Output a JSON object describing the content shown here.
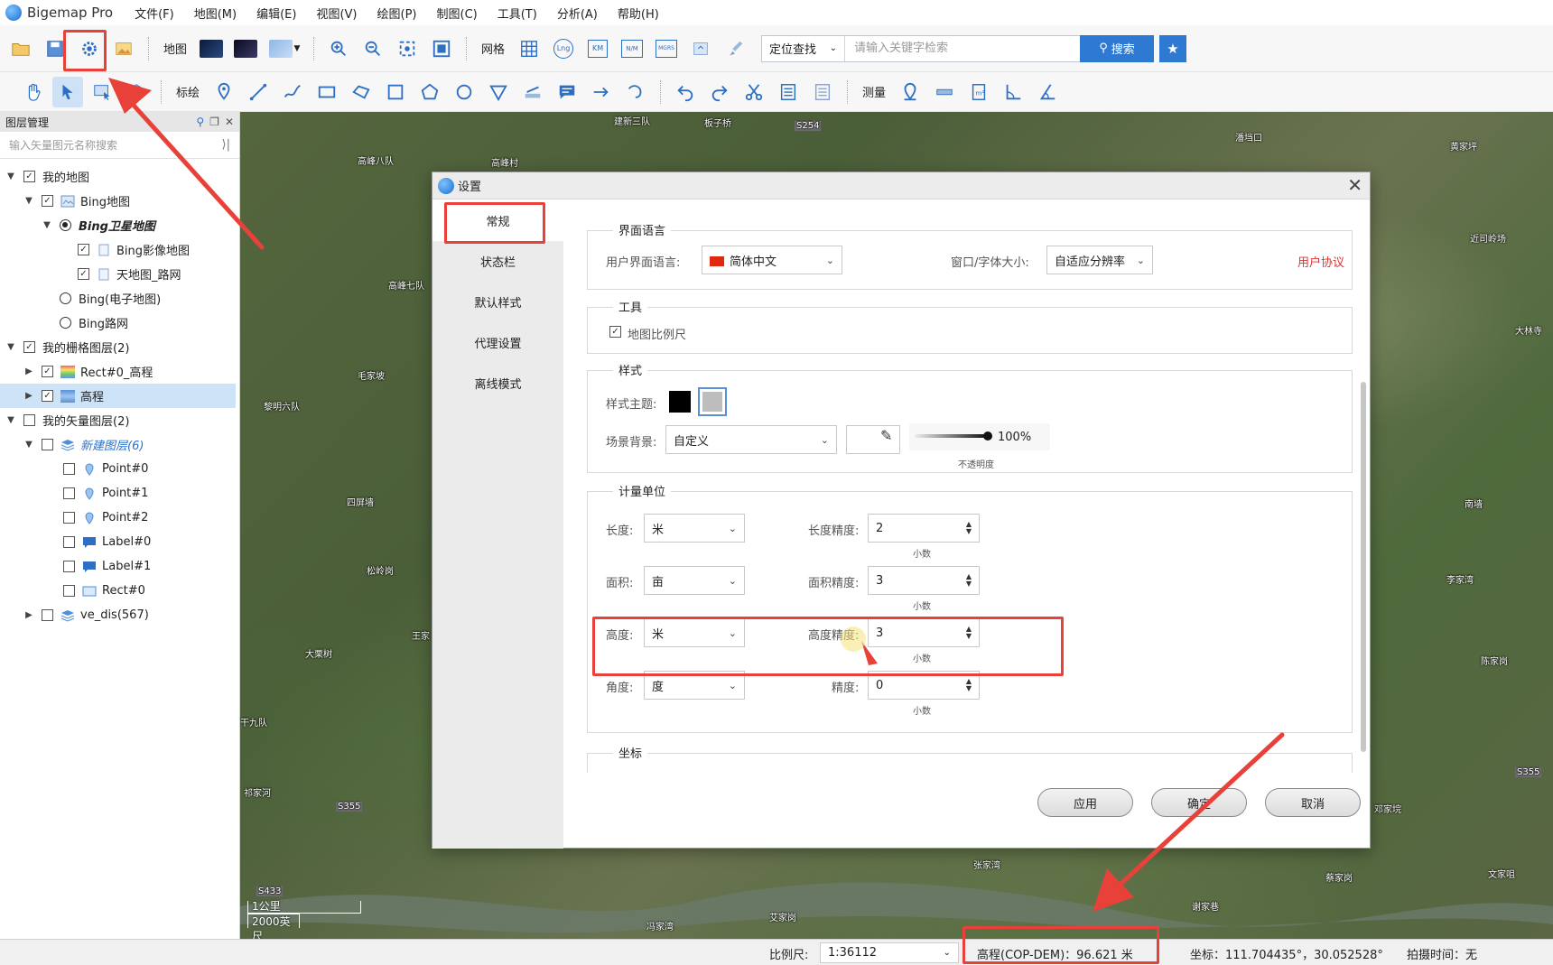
{
  "app": {
    "title": "Bigemap Pro"
  },
  "menu": [
    "文件(F)",
    "地图(M)",
    "编辑(E)",
    "视图(V)",
    "绘图(P)",
    "制图(C)",
    "工具(T)",
    "分析(A)",
    "帮助(H)"
  ],
  "toolbar1": {
    "map_label": "地图",
    "grid_label": "网格",
    "grid_badges": [
      "Lng",
      "KM",
      "N/M",
      "MGRS"
    ],
    "search_type": "定位查找",
    "search_placeholder": "请输入关键字检索",
    "search_button": "搜索"
  },
  "toolbar2": {
    "draw_label": "标绘",
    "measure_label": "测量"
  },
  "layer_panel": {
    "title": "图层管理",
    "search_placeholder": "输入矢量图元名称搜索",
    "tree": [
      {
        "label": "我的地图"
      },
      {
        "label": "Bing地图"
      },
      {
        "label": "Bing卫星地图"
      },
      {
        "label": "Bing影像地图"
      },
      {
        "label": "天地图_路网"
      },
      {
        "label": "Bing(电子地图)"
      },
      {
        "label": "Bing路网"
      },
      {
        "label": "我的栅格图层(2)"
      },
      {
        "label": "Rect#0_高程"
      },
      {
        "label": "高程"
      },
      {
        "label": "我的矢量图层(2)"
      },
      {
        "label": "新建图层(6)"
      },
      {
        "label": "Point#0"
      },
      {
        "label": "Point#1"
      },
      {
        "label": "Point#2"
      },
      {
        "label": "Label#0"
      },
      {
        "label": "Label#1"
      },
      {
        "label": "Rect#0"
      },
      {
        "label": "ve_dis(567)"
      }
    ]
  },
  "map": {
    "labels": [
      "建新三队",
      "板子桥",
      "S254",
      "潘垱口",
      "黄家坪",
      "高峰八队",
      "高峰村",
      "高峰七队",
      "近司岭场",
      "大林寺",
      "毛家坡",
      "黎明六队",
      "四屏墙",
      "松岭岗",
      "王家",
      "大栗树",
      "干九队",
      "祁家河",
      "S355",
      "南墙",
      "李家湾",
      "陈家岗",
      "邓家垸",
      "蔡家岗",
      "文家咀",
      "谢家巷",
      "张家湾",
      "艾家岗",
      "冯家湾",
      "S433",
      "S355"
    ],
    "scale_metric": "1公里",
    "scale_imperial": "2000英尺"
  },
  "status": {
    "scale_label": "比例尺:",
    "scale_value": "1:36112",
    "elevation": "高程(COP-DEM)：96.621 米",
    "coords": "坐标：111.704435°，30.052528°",
    "capture_time": "拍摄时间：无"
  },
  "dialog": {
    "title": "设置",
    "nav": [
      "常规",
      "状态栏",
      "默认样式",
      "代理设置",
      "离线模式"
    ],
    "lang_group": "界面语言",
    "lang_label": "用户界面语言:",
    "lang_value": "简体中文",
    "font_label": "窗口/字体大小:",
    "font_value": "自适应分辨率",
    "user_agreement": "用户协议",
    "tools_group": "工具",
    "scale_checkbox": "地图比例尺",
    "style_group": "样式",
    "theme_label": "样式主题:",
    "bg_label": "场景背景:",
    "bg_value": "自定义",
    "opacity_value": "100%",
    "opacity_label": "不透明度",
    "units_group": "计量单位",
    "length_label": "长度:",
    "length_value": "米",
    "length_prec_label": "长度精度:",
    "length_prec_value": "2",
    "area_label": "面积:",
    "area_value": "亩",
    "area_prec_label": "面积精度:",
    "area_prec_value": "3",
    "height_label": "高度:",
    "height_value": "米",
    "height_prec_label": "高度精度:",
    "height_prec_value": "3",
    "angle_label": "角度:",
    "angle_value": "度",
    "angle_prec_label": "精度:",
    "angle_prec_value": "0",
    "decimal_hint": "小数",
    "coord_group": "坐标",
    "apply": "应用",
    "ok": "确定",
    "cancel": "取消"
  },
  "colors": {
    "accent": "#2e79d2",
    "annotation": "#e8413a",
    "selected": "#cde3f8"
  }
}
